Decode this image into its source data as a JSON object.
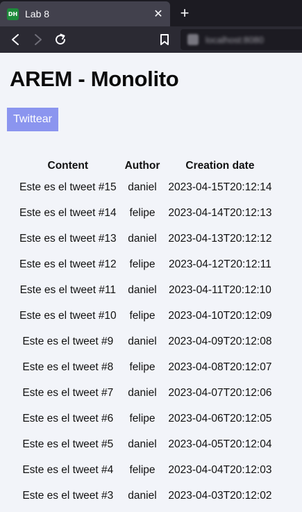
{
  "browser": {
    "tab_title": "Lab 8",
    "favicon_text": "DH",
    "close_glyph": "✕",
    "newtab_glyph": "+",
    "url": "localhost:8080"
  },
  "page": {
    "title": "AREM - Monolito",
    "tweet_button": "Twittear",
    "table": {
      "headers": [
        "Content",
        "Author",
        "Creation date"
      ],
      "rows": [
        [
          "Este es el tweet #15",
          "daniel",
          "2023-04-15T20:12:14"
        ],
        [
          "Este es el tweet #14",
          "felipe",
          "2023-04-14T20:12:13"
        ],
        [
          "Este es el tweet #13",
          "daniel",
          "2023-04-13T20:12:12"
        ],
        [
          "Este es el tweet #12",
          "felipe",
          "2023-04-12T20:12:11"
        ],
        [
          "Este es el tweet #11",
          "daniel",
          "2023-04-11T20:12:10"
        ],
        [
          "Este es el tweet #10",
          "felipe",
          "2023-04-10T20:12:09"
        ],
        [
          "Este es el tweet #9",
          "daniel",
          "2023-04-09T20:12:08"
        ],
        [
          "Este es el tweet #8",
          "felipe",
          "2023-04-08T20:12:07"
        ],
        [
          "Este es el tweet #7",
          "daniel",
          "2023-04-07T20:12:06"
        ],
        [
          "Este es el tweet #6",
          "felipe",
          "2023-04-06T20:12:05"
        ],
        [
          "Este es el tweet #5",
          "daniel",
          "2023-04-05T20:12:04"
        ],
        [
          "Este es el tweet #4",
          "felipe",
          "2023-04-04T20:12:03"
        ],
        [
          "Este es el tweet #3",
          "daniel",
          "2023-04-03T20:12:02"
        ]
      ]
    }
  }
}
